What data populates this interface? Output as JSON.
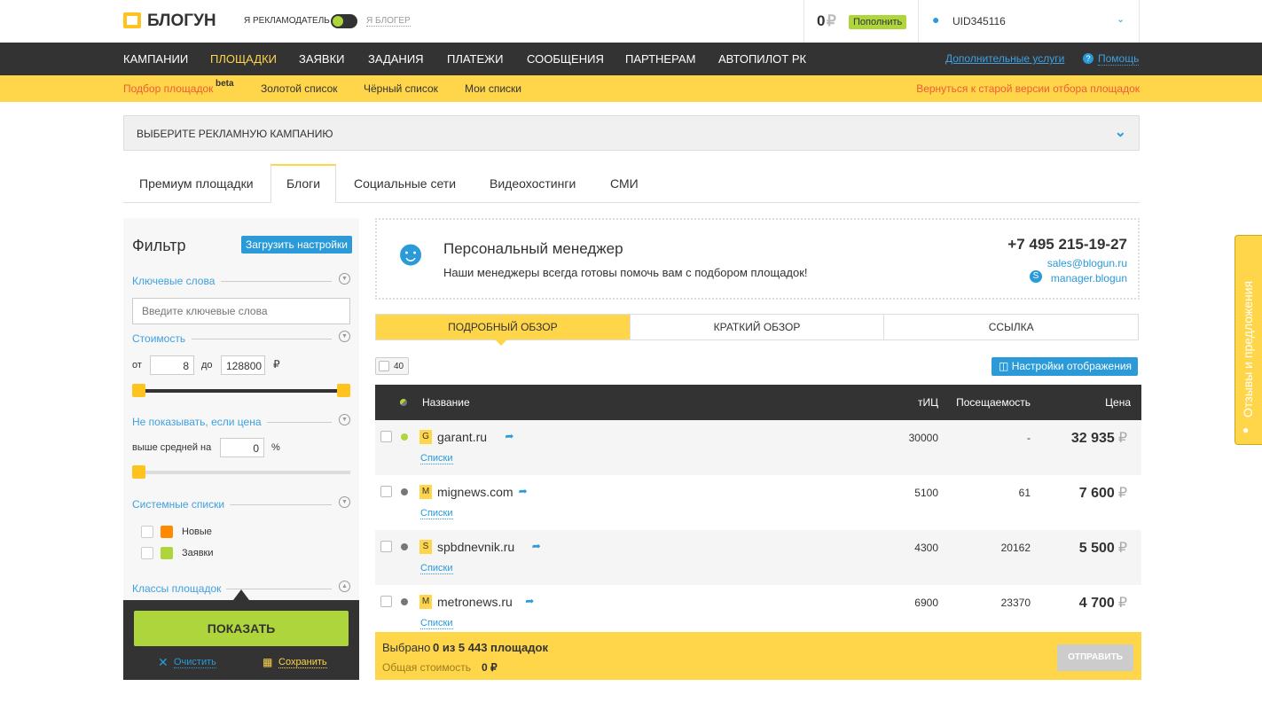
{
  "header": {
    "logo": "БЛОГУН",
    "role_advertiser": "Я РЕКЛАМОДАТЕЛЬ",
    "role_blogger": "Я БЛОГЕР",
    "balance": "0",
    "currency": "₽",
    "topup": "Пополнить",
    "user": "UID345116"
  },
  "nav": {
    "items": [
      "КАМПАНИИ",
      "ПЛОЩАДКИ",
      "ЗАЯВКИ",
      "ЗАДАНИЯ",
      "ПЛАТЕЖИ",
      "СООБЩЕНИЯ",
      "ПАРТНЕРАМ",
      "АВТОПИЛОТ РК"
    ],
    "active": "ПЛОЩАДКИ",
    "extra": "Дополнительные услуги",
    "help": "Помощь"
  },
  "subnav": {
    "items": [
      "Подбор площадок",
      "Золотой список",
      "Чёрный список",
      "Мои списки"
    ],
    "beta": "beta",
    "old_version": "Вернуться к старой версии отбора площадок"
  },
  "campaign_select": "ВЫБЕРИТЕ РЕКЛАМНУЮ КАМПАНИЮ",
  "tabs": [
    "Премиум площадки",
    "Блоги",
    "Социальные сети",
    "Видеохостинги",
    "СМИ"
  ],
  "active_tab": "Блоги",
  "filter": {
    "title": "Фильтр",
    "load": "Загрузить настройки",
    "keywords": "Ключевые слова",
    "keywords_placeholder": "Введите ключевые слова",
    "cost": "Стоимость",
    "from": "от",
    "from_val": "8",
    "to": "до",
    "to_val": "128800",
    "rub": "₽",
    "hide": "Не показывать, если цена",
    "above": "выше средней на",
    "above_val": "0",
    "pct": "%",
    "system_lists": "Системные списки",
    "new": "Новые",
    "requests": "Заявки",
    "classes": "Классы площадок",
    "show": "ПОКАЗАТЬ",
    "clear": "Очистить",
    "save": "Сохранить",
    "colors": {
      "new": "#ff8a00",
      "requests": "#aed63c"
    }
  },
  "manager": {
    "title": "Персональный менеджер",
    "text": "Наши менеджеры всегда готовы помочь вам с подбором площадок!",
    "phone": "+7 495 215-19-27",
    "email": "sales@blogun.ru",
    "skype": "manager.blogun"
  },
  "view_tabs": [
    "ПОДРОБНЫЙ ОБЗОР",
    "КРАТКИЙ ОБЗОР",
    "ССЫЛКА"
  ],
  "per_page": "40",
  "display_settings": "Настройки отображения",
  "table": {
    "headers": {
      "name": "Название",
      "tic": "тИЦ",
      "traffic": "Посещаемость",
      "price": "Цена"
    },
    "rows": [
      {
        "letter": "G",
        "name": "garant.ru",
        "lists": "Списки",
        "tic": "30000",
        "traffic": "-",
        "price": "32 935",
        "status": "#aed63c"
      },
      {
        "letter": "M",
        "name": "mignews.com",
        "lists": "Списки",
        "tic": "5100",
        "traffic": "61",
        "price": "7 600",
        "status": "#777"
      },
      {
        "letter": "S",
        "name": "spbdnevnik.ru",
        "lists": "Списки",
        "tic": "4300",
        "traffic": "20162",
        "price": "5 500",
        "status": "#777"
      },
      {
        "letter": "M",
        "name": "metronews.ru",
        "lists": "Списки",
        "tic": "6900",
        "traffic": "23370",
        "price": "4 700",
        "status": "#777"
      }
    ]
  },
  "footer": {
    "selected_pre": "Выбрано",
    "selected": "0 из 5 443 площадок",
    "total_label": "Общая стоимость",
    "total": "0 ₽",
    "send": "ОТПРАВИТЬ"
  },
  "feedback": "Отзывы и предложения"
}
